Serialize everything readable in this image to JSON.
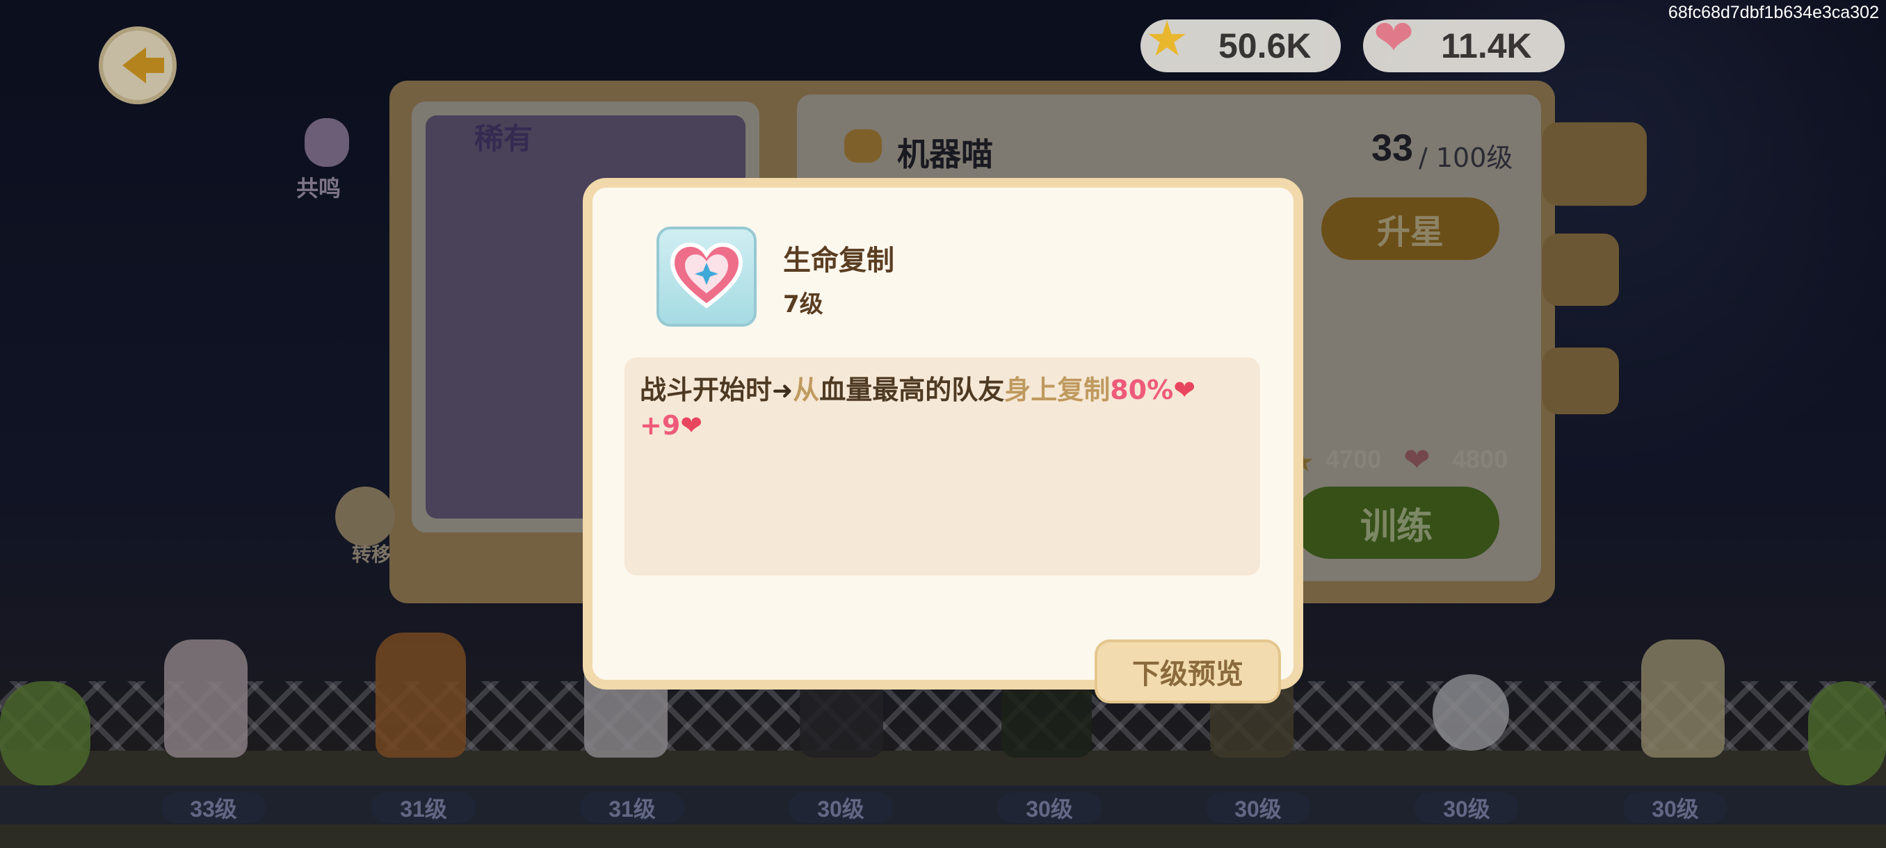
{
  "hash_label": "68fc68d7dbf1b634e3ca302",
  "top_bar": {
    "star_currency": "50.6K",
    "heart_currency": "11.4K"
  },
  "resonance_label": "共鸣",
  "transfer_label": "转移",
  "background_card": {
    "rarity": "稀有",
    "character_name": "机器喵",
    "level": "33",
    "level_max": "/ 100级",
    "upgrade_star_button": "升星",
    "cost_star": "4700",
    "cost_heart": "4800",
    "train_button": "训练"
  },
  "modal": {
    "skill_name": "生命复制",
    "skill_level": "7级",
    "description": {
      "line1": [
        {
          "text": "战斗开始时",
          "color": "dark"
        },
        {
          "text": "➜",
          "color": "arrow"
        },
        {
          "text": "从",
          "color": "tan"
        },
        {
          "text": "血量最高的队友",
          "color": "dark"
        },
        {
          "text": "身上复制",
          "color": "tan"
        },
        {
          "text": "80%",
          "color": "pink"
        },
        {
          "text": "❤",
          "color": "heart"
        }
      ],
      "line2": [
        {
          "text": "+9",
          "color": "pink"
        },
        {
          "text": "❤",
          "color": "heart"
        }
      ]
    },
    "preview_button": "下级预览"
  },
  "roster_levels": [
    "33级",
    "31级",
    "31级",
    "30级",
    "30级",
    "30级",
    "30级",
    "30级"
  ],
  "colors": {
    "modal_bg": "#fdf8ee",
    "modal_border": "#f1d9ab",
    "text_dark": "#4e3a23",
    "text_tan": "#bf9a5f",
    "text_pink": "#ee5b7a"
  }
}
